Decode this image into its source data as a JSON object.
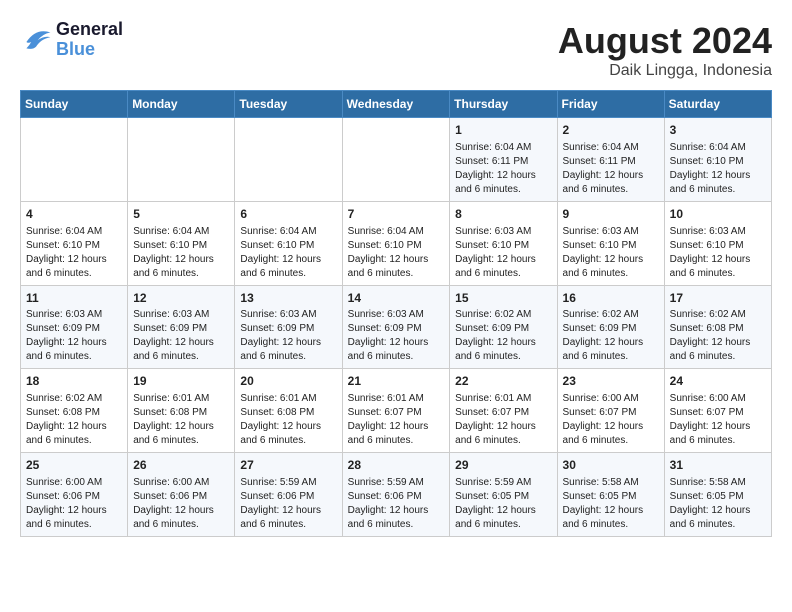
{
  "logo": {
    "line1": "General",
    "line2": "Blue"
  },
  "title": "August 2024",
  "subtitle": "Daik Lingga, Indonesia",
  "days_of_week": [
    "Sunday",
    "Monday",
    "Tuesday",
    "Wednesday",
    "Thursday",
    "Friday",
    "Saturday"
  ],
  "weeks": [
    [
      {
        "day": "",
        "content": ""
      },
      {
        "day": "",
        "content": ""
      },
      {
        "day": "",
        "content": ""
      },
      {
        "day": "",
        "content": ""
      },
      {
        "day": "1",
        "content": "Sunrise: 6:04 AM\nSunset: 6:11 PM\nDaylight: 12 hours and 6 minutes."
      },
      {
        "day": "2",
        "content": "Sunrise: 6:04 AM\nSunset: 6:11 PM\nDaylight: 12 hours and 6 minutes."
      },
      {
        "day": "3",
        "content": "Sunrise: 6:04 AM\nSunset: 6:10 PM\nDaylight: 12 hours and 6 minutes."
      }
    ],
    [
      {
        "day": "4",
        "content": "Sunrise: 6:04 AM\nSunset: 6:10 PM\nDaylight: 12 hours and 6 minutes."
      },
      {
        "day": "5",
        "content": "Sunrise: 6:04 AM\nSunset: 6:10 PM\nDaylight: 12 hours and 6 minutes."
      },
      {
        "day": "6",
        "content": "Sunrise: 6:04 AM\nSunset: 6:10 PM\nDaylight: 12 hours and 6 minutes."
      },
      {
        "day": "7",
        "content": "Sunrise: 6:04 AM\nSunset: 6:10 PM\nDaylight: 12 hours and 6 minutes."
      },
      {
        "day": "8",
        "content": "Sunrise: 6:03 AM\nSunset: 6:10 PM\nDaylight: 12 hours and 6 minutes."
      },
      {
        "day": "9",
        "content": "Sunrise: 6:03 AM\nSunset: 6:10 PM\nDaylight: 12 hours and 6 minutes."
      },
      {
        "day": "10",
        "content": "Sunrise: 6:03 AM\nSunset: 6:10 PM\nDaylight: 12 hours and 6 minutes."
      }
    ],
    [
      {
        "day": "11",
        "content": "Sunrise: 6:03 AM\nSunset: 6:09 PM\nDaylight: 12 hours and 6 minutes."
      },
      {
        "day": "12",
        "content": "Sunrise: 6:03 AM\nSunset: 6:09 PM\nDaylight: 12 hours and 6 minutes."
      },
      {
        "day": "13",
        "content": "Sunrise: 6:03 AM\nSunset: 6:09 PM\nDaylight: 12 hours and 6 minutes."
      },
      {
        "day": "14",
        "content": "Sunrise: 6:03 AM\nSunset: 6:09 PM\nDaylight: 12 hours and 6 minutes."
      },
      {
        "day": "15",
        "content": "Sunrise: 6:02 AM\nSunset: 6:09 PM\nDaylight: 12 hours and 6 minutes."
      },
      {
        "day": "16",
        "content": "Sunrise: 6:02 AM\nSunset: 6:09 PM\nDaylight: 12 hours and 6 minutes."
      },
      {
        "day": "17",
        "content": "Sunrise: 6:02 AM\nSunset: 6:08 PM\nDaylight: 12 hours and 6 minutes."
      }
    ],
    [
      {
        "day": "18",
        "content": "Sunrise: 6:02 AM\nSunset: 6:08 PM\nDaylight: 12 hours and 6 minutes."
      },
      {
        "day": "19",
        "content": "Sunrise: 6:01 AM\nSunset: 6:08 PM\nDaylight: 12 hours and 6 minutes."
      },
      {
        "day": "20",
        "content": "Sunrise: 6:01 AM\nSunset: 6:08 PM\nDaylight: 12 hours and 6 minutes."
      },
      {
        "day": "21",
        "content": "Sunrise: 6:01 AM\nSunset: 6:07 PM\nDaylight: 12 hours and 6 minutes."
      },
      {
        "day": "22",
        "content": "Sunrise: 6:01 AM\nSunset: 6:07 PM\nDaylight: 12 hours and 6 minutes."
      },
      {
        "day": "23",
        "content": "Sunrise: 6:00 AM\nSunset: 6:07 PM\nDaylight: 12 hours and 6 minutes."
      },
      {
        "day": "24",
        "content": "Sunrise: 6:00 AM\nSunset: 6:07 PM\nDaylight: 12 hours and 6 minutes."
      }
    ],
    [
      {
        "day": "25",
        "content": "Sunrise: 6:00 AM\nSunset: 6:06 PM\nDaylight: 12 hours and 6 minutes."
      },
      {
        "day": "26",
        "content": "Sunrise: 6:00 AM\nSunset: 6:06 PM\nDaylight: 12 hours and 6 minutes."
      },
      {
        "day": "27",
        "content": "Sunrise: 5:59 AM\nSunset: 6:06 PM\nDaylight: 12 hours and 6 minutes."
      },
      {
        "day": "28",
        "content": "Sunrise: 5:59 AM\nSunset: 6:06 PM\nDaylight: 12 hours and 6 minutes."
      },
      {
        "day": "29",
        "content": "Sunrise: 5:59 AM\nSunset: 6:05 PM\nDaylight: 12 hours and 6 minutes."
      },
      {
        "day": "30",
        "content": "Sunrise: 5:58 AM\nSunset: 6:05 PM\nDaylight: 12 hours and 6 minutes."
      },
      {
        "day": "31",
        "content": "Sunrise: 5:58 AM\nSunset: 6:05 PM\nDaylight: 12 hours and 6 minutes."
      }
    ]
  ]
}
